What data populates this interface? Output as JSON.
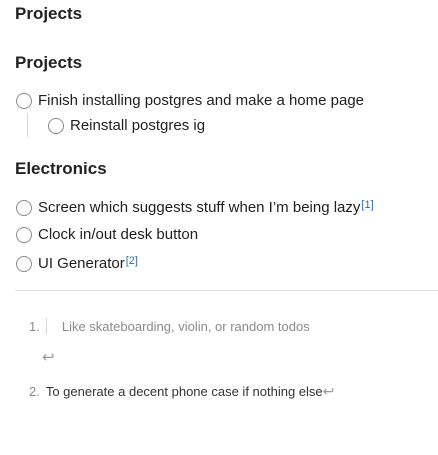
{
  "page": {
    "title": "Projects"
  },
  "sections": [
    {
      "heading": "Projects",
      "tasks": [
        {
          "label": "Finish installing postgres and make a home page",
          "checked": false
        },
        {
          "label": "Reinstall postgres ig",
          "checked": false,
          "indented": true
        }
      ]
    },
    {
      "heading": "Electronics",
      "tasks": [
        {
          "label": "Screen which suggests stuff when I’m being lazy",
          "footnote_ref": "[1]",
          "checked": false
        },
        {
          "label": "Clock in/out desk button",
          "checked": false
        },
        {
          "label": "UI Generator",
          "footnote_ref": "[2]",
          "checked": false
        }
      ]
    }
  ],
  "footnotes": [
    {
      "number": "1.",
      "text": "Like skateboarding, violin, or random todos"
    },
    {
      "number": "2.",
      "text": "To generate a decent phone case if nothing else"
    }
  ],
  "icons": {
    "return": "return-arrow-icon",
    "return_glyph": "↩"
  }
}
